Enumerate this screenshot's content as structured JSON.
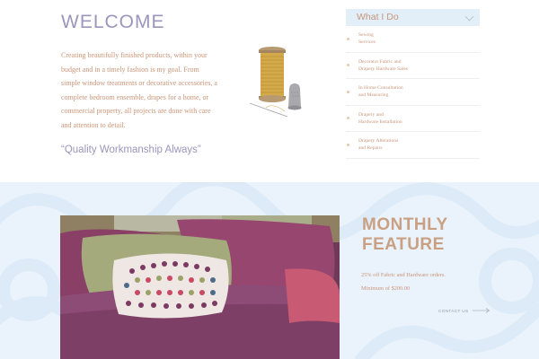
{
  "welcome": {
    "title": "WELCOME",
    "intro": "Creating beautifully finished products, within your budget and in a timely fashion is my goal. From simple window treatments or decorative accessories,  a complete bedroom ensemble, drapes for a home, or commercial property, all projects are done with care and attention to detail.",
    "tagline": "“Quality Workmanship Always”"
  },
  "what_i_do": {
    "title": "What I Do",
    "items": [
      {
        "label": "Sewing\nServices"
      },
      {
        "label": "Decorator Fabric and\nDrapery Hardware Sales"
      },
      {
        "label": "In Home Consultation\nand Measuring"
      },
      {
        "label": "Drapery and\nHardware Installation"
      },
      {
        "label": "Drapery Alterations\nand Repairs"
      }
    ]
  },
  "monthly_feature": {
    "title_line1": "MONTHLY",
    "title_line2": "FEATURE",
    "offer": "25% off Fabric and Hardware orders.",
    "minimum": "Minimum of $200.00",
    "contact_label": "CONTACT US"
  },
  "colors": {
    "accent_lavender": "#9b96bc",
    "accent_copper": "#c9957a",
    "panel_blue": "#e3eff8",
    "section_background": "#eaf3fb"
  },
  "icons": {
    "chevron": "chevron-down-icon",
    "contact_arrow": "arrow-right-icon"
  }
}
